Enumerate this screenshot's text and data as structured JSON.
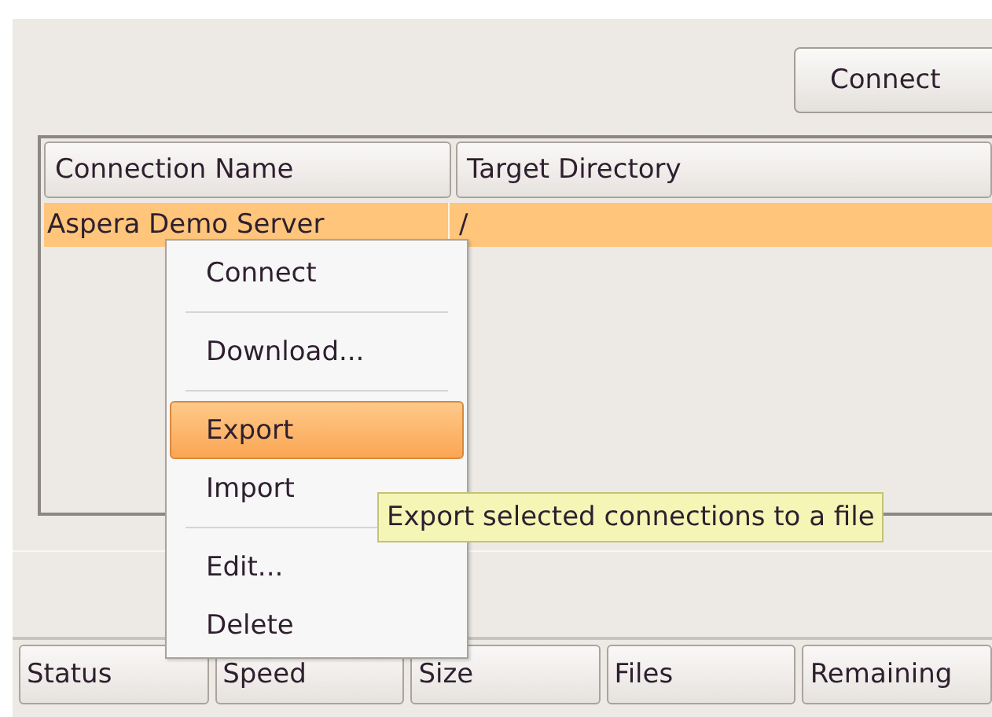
{
  "connect_button": {
    "label": "Connect"
  },
  "connections_table": {
    "columns": [
      "Connection Name",
      "Target Directory"
    ],
    "rows": [
      {
        "cells": [
          "Aspera Demo Server",
          "/"
        ],
        "selected": true
      }
    ]
  },
  "context_menu": {
    "items": [
      {
        "kind": "item",
        "label": "Connect",
        "selected": false
      },
      {
        "kind": "separator"
      },
      {
        "kind": "item",
        "label": "Download...",
        "selected": false
      },
      {
        "kind": "separator"
      },
      {
        "kind": "item",
        "label": "Export",
        "selected": true
      },
      {
        "kind": "item",
        "label": "Import",
        "selected": false
      },
      {
        "kind": "separator"
      },
      {
        "kind": "item",
        "label": "Edit...",
        "selected": false
      },
      {
        "kind": "item",
        "label": "Delete",
        "selected": false
      }
    ]
  },
  "tooltip": {
    "text": "Export selected connections to a file"
  },
  "transfers_table": {
    "columns": [
      "Status",
      "Speed",
      "Size",
      "Files",
      "Remaining"
    ]
  }
}
